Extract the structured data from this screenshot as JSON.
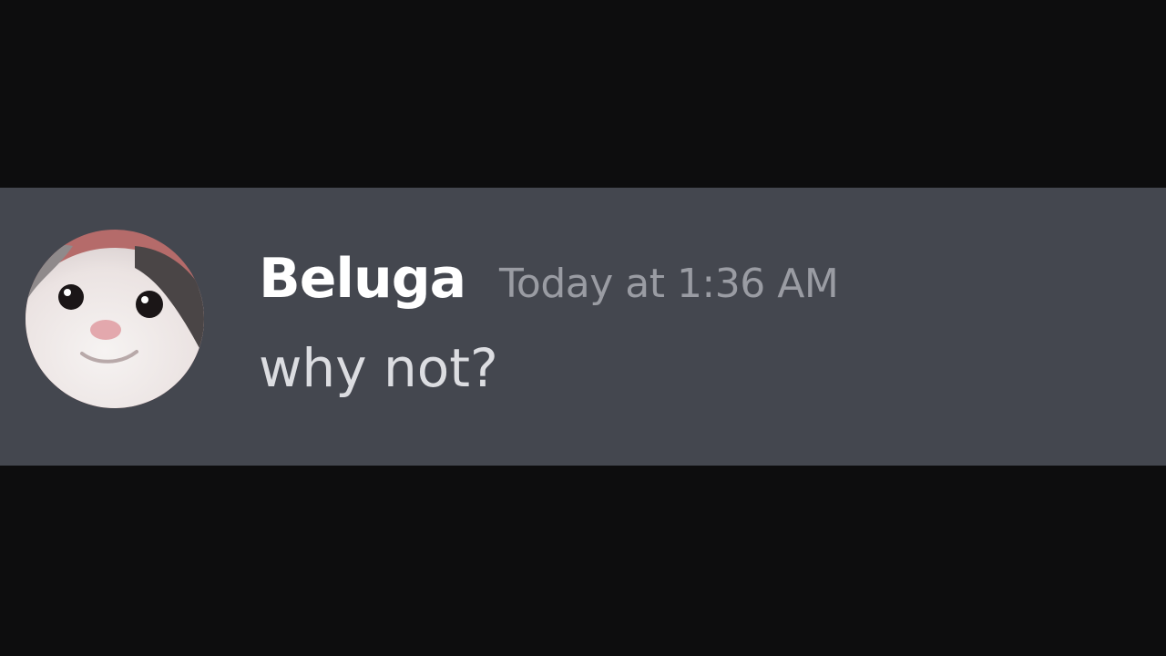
{
  "message": {
    "author": "Beluga",
    "timestamp": "Today at 1:36 AM",
    "content": "why not?",
    "avatar_icon": "beluga-cat-avatar-icon"
  },
  "colors": {
    "background": "#0d0d0e",
    "message_bg": "#44474f",
    "username": "#ffffff",
    "timestamp": "#9a9ca3",
    "content": "#dcdde1"
  }
}
